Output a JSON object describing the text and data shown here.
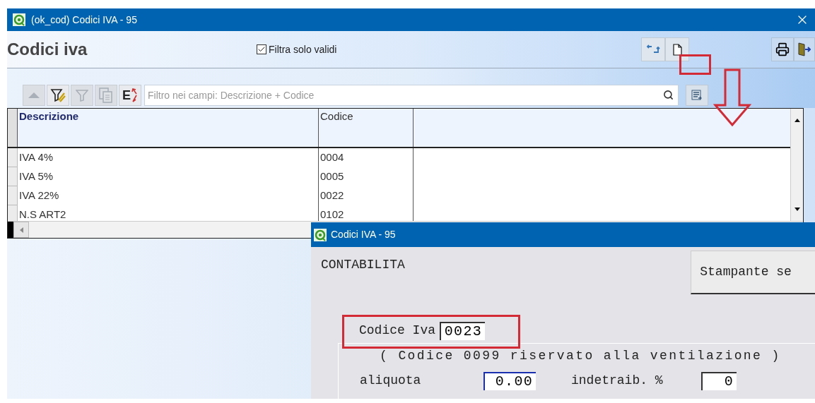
{
  "window": {
    "title": "(ok_cod) Codici IVA - 95"
  },
  "header": {
    "title": "Codici iva",
    "filter_checkbox": {
      "label": "Filtra solo validi",
      "checked": true
    }
  },
  "toolbar": [
    {
      "kind": "up",
      "disabled": true
    },
    {
      "kind": "filter-edit",
      "disabled": false
    },
    {
      "kind": "filter",
      "disabled": true
    },
    {
      "kind": "copy",
      "disabled": true
    },
    {
      "kind": "letter",
      "label": "E",
      "disabled": false
    }
  ],
  "search": {
    "placeholder": "Filtro nei campi: Descrizione + Codice"
  },
  "table": {
    "columns": [
      {
        "label": "Descrizione",
        "sorted": true
      },
      {
        "label": "Codice",
        "sorted": false
      }
    ],
    "rows": [
      [
        "IVA 4%",
        "0004"
      ],
      [
        "IVA 5%",
        "0005"
      ],
      [
        "IVA 22%",
        "0022"
      ],
      [
        "N.S ART2",
        "0102"
      ]
    ]
  },
  "dialog": {
    "title": "Codici IVA - 95",
    "section": "CONTABILITA",
    "printer_button": "Stampante se",
    "code_field": {
      "label": "Codice Iva",
      "value": "0023"
    },
    "note": "( Codice 0099 riservato alla ventilazione )",
    "rate_field": {
      "label": "aliquota",
      "value": "0.00"
    },
    "nondeductible_field": {
      "label": "indetraib. %",
      "value": "0"
    }
  }
}
